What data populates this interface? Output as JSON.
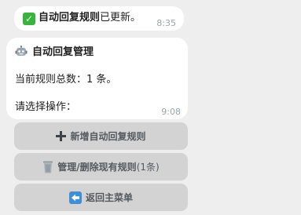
{
  "messages": [
    {
      "icon": "check-mark-icon",
      "bold_text": "自动回复规则",
      "text": "已更新。",
      "time": "8:35"
    },
    {
      "icon": "robot-icon",
      "title": "自动回复管理",
      "count_line": "当前规则总数：1 条。",
      "prompt_line": "请选择操作：",
      "time": "9:08"
    }
  ],
  "keyboard": [
    {
      "icon": "plus-icon",
      "label": "新增自动回复规则"
    },
    {
      "icon": "wastebasket-icon",
      "label": "管理/删除现有规则",
      "suffix": " (1条)"
    },
    {
      "icon": "back-arrow-icon",
      "label": "返回主菜单"
    }
  ],
  "colors": {
    "background": "#eeeeee",
    "bubble": "#ffffff",
    "button": "#d3d3d3",
    "check": "#35b53a",
    "time": "#9aa3ab"
  }
}
